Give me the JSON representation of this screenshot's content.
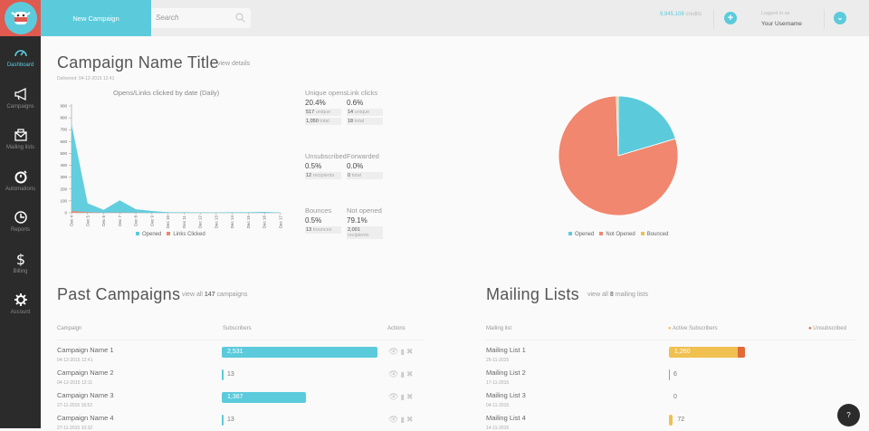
{
  "sidebar": {
    "items": [
      {
        "label": "Dashboard",
        "icon": "speedometer-icon",
        "active": true
      },
      {
        "label": "Campaigns",
        "icon": "megaphone-icon"
      },
      {
        "label": "Mailing lists",
        "icon": "mail-icon"
      },
      {
        "label": "Automations",
        "icon": "timer-icon"
      },
      {
        "label": "Reports",
        "icon": "clock-icon"
      },
      {
        "label": "Billing",
        "icon": "dollar-icon"
      },
      {
        "label": "Account",
        "icon": "gear-icon"
      }
    ]
  },
  "topbar": {
    "new_campaign": "New Campaign",
    "search_placeholder": "Search",
    "credits_value": "9,945,108",
    "credits_label": "credits",
    "logged_in_label": "Logged in as",
    "username": "Your Username"
  },
  "campaign": {
    "title": "Campaign Name Title",
    "view_details": "view details",
    "delivered": "Delivered: 04-12-2015 12:41"
  },
  "stats": [
    {
      "label": "Unique opens",
      "pct": "20.4%",
      "rows": [
        {
          "n": "517",
          "u": "unique"
        },
        {
          "n": "1,050",
          "u": "total"
        }
      ]
    },
    {
      "label": "Link clicks",
      "pct": "0.6%",
      "rows": [
        {
          "n": "14",
          "u": "unique"
        },
        {
          "n": "18",
          "u": "total"
        }
      ]
    },
    {
      "label": "Unsubscribed",
      "pct": "0.5%",
      "rows": [
        {
          "n": "12",
          "u": "recipients"
        }
      ]
    },
    {
      "label": "Forwarded",
      "pct": "0.0%",
      "rows": [
        {
          "n": "0",
          "u": "total"
        }
      ]
    },
    {
      "label": "Bounces",
      "pct": "0.5%",
      "rows": [
        {
          "n": "13",
          "u": "bounces"
        }
      ]
    },
    {
      "label": "Not opened",
      "pct": "79.1%",
      "rows": [
        {
          "n": "2,001",
          "u": "recipients"
        }
      ]
    }
  ],
  "chart_data": [
    {
      "type": "area",
      "title": "Opens/Links clicked by date (Daily)",
      "x": [
        "Dec 4",
        "Dec 5",
        "Dec 6",
        "Dec 7",
        "Dec 8",
        "Dec 9",
        "Dec 10",
        "Dec 11",
        "Dec 12",
        "Dec 13",
        "Dec 14",
        "Dec 15",
        "Dec 16",
        "Dec 17"
      ],
      "ylim": [
        0,
        900
      ],
      "yticks": [
        0,
        100,
        200,
        300,
        400,
        500,
        600,
        700,
        800,
        900
      ],
      "legend": "bottom",
      "series": [
        {
          "name": "Opened",
          "color": "#5bcbdc",
          "values": [
            750,
            80,
            25,
            105,
            30,
            15,
            5,
            5,
            3,
            3,
            5,
            5,
            8,
            2
          ]
        },
        {
          "name": "Links Clicked",
          "color": "#f0876e",
          "values": [
            15,
            5,
            1,
            2,
            1,
            0,
            0,
            0,
            0,
            0,
            0,
            0,
            0,
            0
          ]
        }
      ]
    },
    {
      "type": "pie",
      "legend": "bottom",
      "slices": [
        {
          "name": "Opened",
          "value": 20.4,
          "color": "#5bcbdc"
        },
        {
          "name": "Not Opened",
          "value": 79.1,
          "color": "#f0876e"
        },
        {
          "name": "Bounced",
          "value": 0.5,
          "color": "#f0c050"
        }
      ]
    }
  ],
  "past": {
    "title": "Past Campaigns",
    "view_all_pre": "view all",
    "count": "147",
    "view_all_post": "campaigns",
    "headers": [
      "Campaign",
      "Subscribers",
      "Actions"
    ],
    "rows": [
      {
        "name": "Campaign Name 1",
        "date": "04-12-2015 12:41",
        "subs": 2531,
        "label": "2,531"
      },
      {
        "name": "Campaign Name 2",
        "date": "04-12-2015 12:11",
        "subs": 13,
        "label": "13"
      },
      {
        "name": "Campaign Name 3",
        "date": "27-11-2015 16:52",
        "subs": 1367,
        "label": "1,367"
      },
      {
        "name": "Campaign Name 4",
        "date": "27-11-2015 10:32",
        "subs": 13,
        "label": "13"
      }
    ]
  },
  "lists": {
    "title": "Mailing Lists",
    "view_all_pre": "view all",
    "count": "8",
    "view_all_post": "mailing lists",
    "headers": [
      "Mailing list",
      "Active Subscribers",
      "Unsubscribed"
    ],
    "rows": [
      {
        "name": "Mailing List 1",
        "date": "25-11-2015",
        "active": 1260,
        "unsub": 12,
        "label": "1,260"
      },
      {
        "name": "Mailing List 2",
        "date": "17-11-2015",
        "active": 6,
        "unsub": 0,
        "label": "6"
      },
      {
        "name": "Mailing List 3",
        "date": "04-11-2015",
        "active": 0,
        "unsub": 0,
        "label": "0"
      },
      {
        "name": "Mailing List 4",
        "date": "14-11-2015",
        "active": 72,
        "unsub": 0,
        "label": "72"
      }
    ]
  },
  "help": "?"
}
